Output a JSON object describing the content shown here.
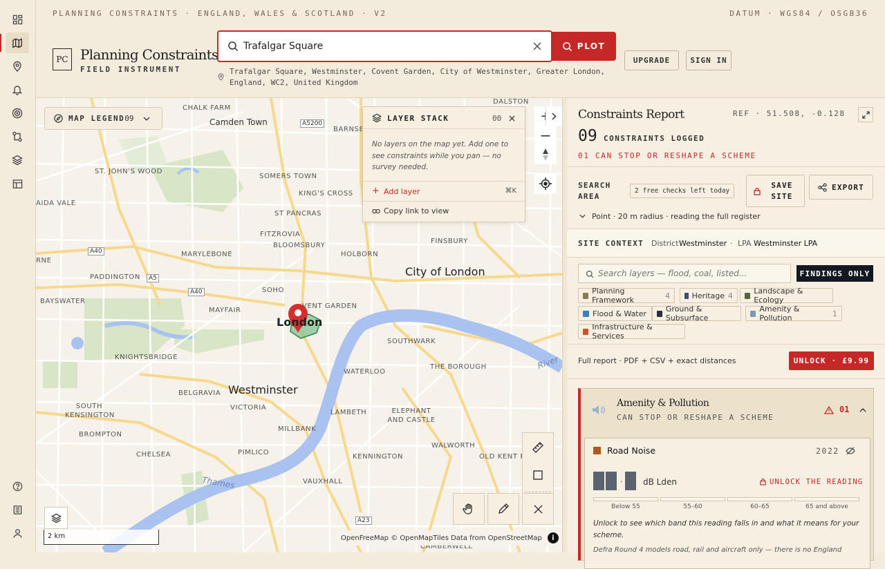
{
  "rail": {
    "items": [
      "dashboard-icon",
      "map-icon",
      "pin-icon",
      "bell-icon",
      "target-icon",
      "compare-icon",
      "layers-icon",
      "table-icon"
    ],
    "bottom": [
      "help-icon",
      "bank-icon",
      "user-icon"
    ]
  },
  "header": {
    "topline": "PLANNING CONSTRAINTS · ENGLAND, WALES & SCOTLAND · V2",
    "datum": "DATUM · WGS84 / OSGB36",
    "logo_mark": "PC",
    "brand": "Planning Constraints",
    "brand_sub": "FIELD INSTRUMENT",
    "search_value": "Trafalgar Square",
    "plot_label": "PLOT",
    "upgrade_label": "UPGRADE",
    "signin_label": "SIGN IN",
    "address": "Trafalgar Square, Westminster, Covent Garden, City of Westminster, Greater London, England, WC2, United Kingdom"
  },
  "map": {
    "legend_label": "MAP LEGEND",
    "legend_count": "09",
    "layer_stack": {
      "title": "LAYER STACK",
      "count": "00",
      "empty_text": "No layers on the map yet. Add one to see constraints while you pan — no survey needed.",
      "add_label": "Add layer",
      "add_shortcut": "⌘K",
      "copy_label": "Copy link to view"
    },
    "scale_label": "2 km",
    "attribution": "OpenFreeMap © OpenMapTiles Data from OpenStreetMap",
    "labels": {
      "chalk_farm": "CHALK FARM",
      "camden_town": "Camden Town",
      "dalston": "DALSTON",
      "barnsbury": "BARNSBURY",
      "st_johns_wood": "ST. JOHN'S WOOD",
      "somers_town": "SOMERS TOWN",
      "kings_cross": "KING'S CROSS",
      "maida_vale": "AIDA VALE",
      "st_pancras": "ST PANCRAS",
      "fitzrovia": "FITZROVIA",
      "bloomsbury": "BLOOMSBURY",
      "finsbury": "FINSBURY",
      "marylebone": "MARYLEBONE",
      "holborn": "HOLBORN",
      "bourne": "RNE",
      "paddington": "PADDINGTON",
      "city_of_london": "City of London",
      "soho": "SOHO",
      "bayswater": "BAYSWATER",
      "covent_garden": "VENT GARDEN",
      "mayfair": "MAYFAIR",
      "london": "London",
      "southwark": "SOUTHWARK",
      "knightsbridge": "KNIGHTSBRIDGE",
      "waterloo": "WATERLOO",
      "the_borough": "THE BOROUGH",
      "belgravia": "BELGRAVIA",
      "westminster": "Westminster",
      "south_kensington": "SOUTH KENSINGTON",
      "victoria": "VICTORIA",
      "lambeth": "LAMBETH",
      "elephant_castle": "ELEPHANT AND CASTLE",
      "brompton": "BROMPTON",
      "millbank": "MILLBANK",
      "chelsea": "CHELSEA",
      "pimlico": "PIMLICO",
      "kennington": "KENNINGTON",
      "walworth": "WALWORTH",
      "old_kent_road": "OLD KENT ROAD",
      "vauxhall": "VAUXHALL",
      "camberwell": "CAMBERWELL",
      "thames": "Thames",
      "river": "River"
    },
    "roads": {
      "a5200": "A5200",
      "a40a": "A40",
      "a5": "A5",
      "a40b": "A40",
      "a23": "A23"
    }
  },
  "panel": {
    "title": "Constraints Report",
    "ref": "REF · 51.508, -0.128",
    "count": "09",
    "count_label": "CONSTRAINTS LOGGED",
    "stop_line": "01 CAN STOP OR RESHAPE A SCHEME",
    "search_area_label": "SEARCH AREA",
    "free_checks": "2 free checks left today",
    "save_site": "SAVE SITE",
    "export": "EXPORT",
    "radius": "Point · 20 m radius · reading the full register",
    "site_context_label": "SITE CONTEXT",
    "district_label": "District",
    "district": "Westminster",
    "lpa_label": "LPA",
    "lpa": "Westminster LPA",
    "filter_placeholder": "Search layers — flood, coal, listed...",
    "findings_only": "FINDINGS ONLY",
    "chips": [
      {
        "label": "Planning Framework",
        "count": "4",
        "color": "#8a7a5a"
      },
      {
        "label": "Heritage",
        "count": "4",
        "color": "#3c4f6e"
      },
      {
        "label": "Landscape & Ecology",
        "count": "",
        "color": "#4d6b35"
      },
      {
        "label": "Flood & Water",
        "count": "",
        "color": "#3d7fb8"
      },
      {
        "label": "Ground & Subsurface",
        "count": "",
        "color": "#2a3038"
      },
      {
        "label": "Amenity & Pollution",
        "count": "1",
        "color": "#7d9bb8"
      },
      {
        "label": "Infrastructure & Services",
        "count": "",
        "color": "#c9542a"
      }
    ],
    "full_report": "Full report · PDF + CSV + exact distances",
    "unlock_price": "UNLOCK · £9.99",
    "section_title": "Amenity & Pollution",
    "section_sub": "CAN STOP OR RESHAPE A SCHEME",
    "section_count": "01",
    "card_title": "Road Noise",
    "card_year": "2022",
    "unit": "dB Lden",
    "unlock_reading": "UNLOCK THE READING",
    "bands": [
      "Below 55",
      "55–60",
      "60–65",
      "65 and above"
    ],
    "unlock_note": "Unlock to see which band this reading falls in and what it means for your scheme.",
    "defra_note": "Defra Round 4 models road, rail and aircraft only — there is no England"
  },
  "colors": {
    "accent": "#c62828",
    "bg": "#f3ecdd",
    "panel": "#f6efe2",
    "dark": "#141820"
  }
}
